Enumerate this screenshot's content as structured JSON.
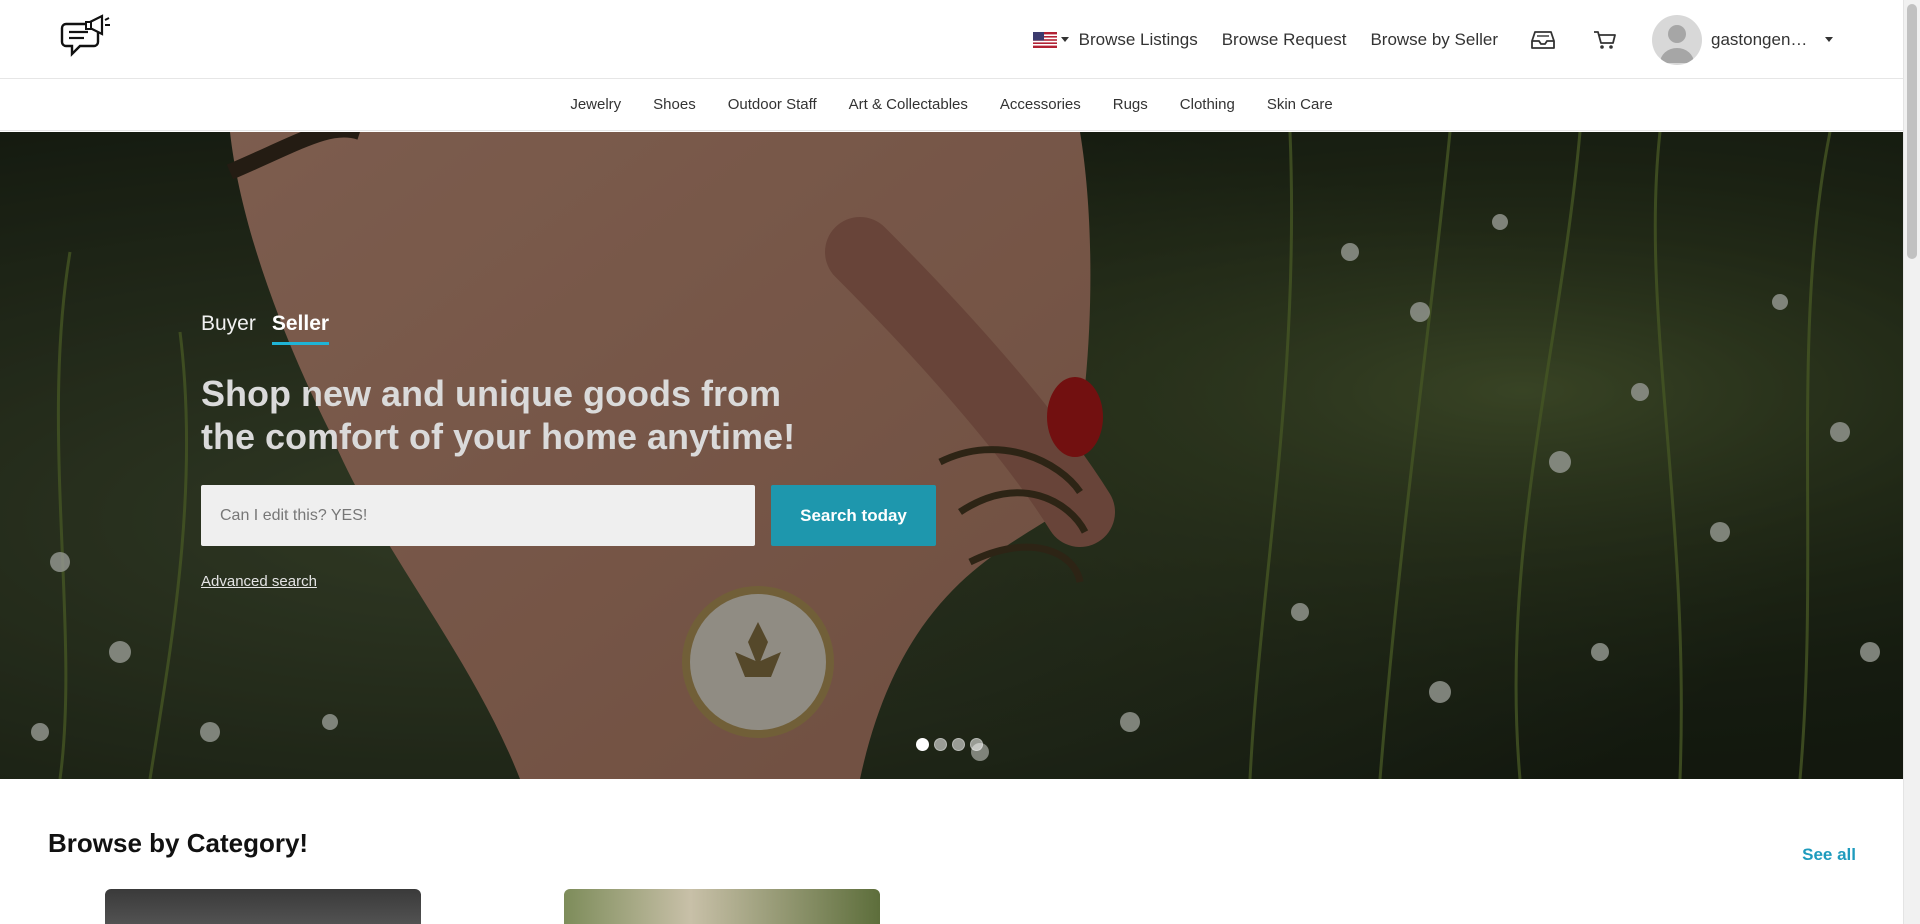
{
  "header": {
    "logo_icon": "megaphone-chat-logo-icon",
    "locale_flag_icon": "us-flag-icon",
    "nav": [
      "Browse Listings",
      "Browse Request",
      "Browse by Seller"
    ],
    "inbox_icon": "inbox-icon",
    "cart_icon": "cart-icon",
    "user_name": "gastongena..."
  },
  "categories": [
    "Jewelry",
    "Shoes",
    "Outdoor Staff",
    "Art & Collectables",
    "Accessories",
    "Rugs",
    "Clothing",
    "Skin Care"
  ],
  "hero": {
    "tabs": [
      "Buyer",
      "Seller"
    ],
    "active_tab": "Seller",
    "title": "Shop new and unique goods from the comfort of your home anytime!",
    "search_value": "Can I edit this? YES!",
    "search_button": "Search today",
    "advanced_search": "Advanced search",
    "slide_count": 4,
    "active_slide": 1
  },
  "browse": {
    "title": "Browse by Category!",
    "see_all": "See all"
  },
  "colors": {
    "accent": "#1fb4d6",
    "button": "#1e97ad",
    "link": "#1e9bbd"
  }
}
